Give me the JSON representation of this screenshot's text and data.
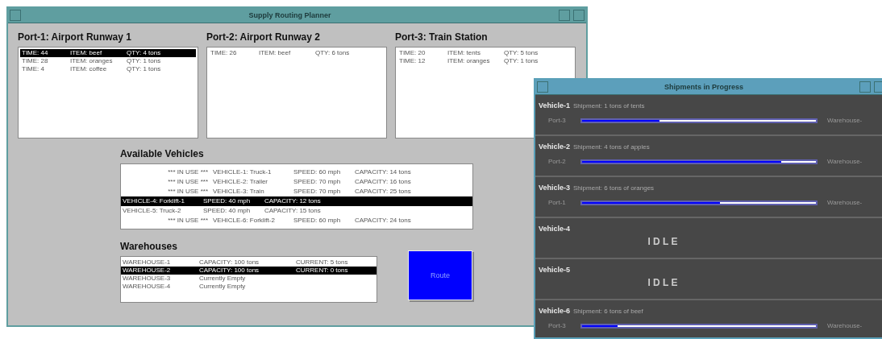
{
  "main_window": {
    "title": "Supply Routing Planner",
    "ports": [
      {
        "title": "Port-1: Airport Runway 1",
        "orders": [
          {
            "time": "TIME: 44",
            "item": "ITEM: beef",
            "qty": "QTY: 4 tons",
            "selected": true
          },
          {
            "time": "TIME: 28",
            "item": "ITEM: oranges",
            "qty": "QTY: 1 tons",
            "selected": false
          },
          {
            "time": "TIME: 4",
            "item": "ITEM: coffee",
            "qty": "QTY: 1 tons",
            "selected": false
          }
        ]
      },
      {
        "title": "Port-2: Airport Runway 2",
        "orders": [
          {
            "time": "TIME: 26",
            "item": "ITEM: beef",
            "qty": "QTY: 6 tons",
            "selected": false
          }
        ]
      },
      {
        "title": "Port-3: Train Station",
        "orders": [
          {
            "time": "TIME: 20",
            "item": "ITEM: tents",
            "qty": "QTY: 5 tons",
            "selected": false
          },
          {
            "time": "TIME: 12",
            "item": "ITEM: oranges",
            "qty": "QTY: 1 tons",
            "selected": false
          }
        ]
      }
    ],
    "vehicles_title": "Available Vehicles",
    "vehicles": [
      {
        "in_use": "*** IN USE ***",
        "vehicle": "VEHICLE-1: Truck-1",
        "speed": "SPEED: 60 mph",
        "capacity": "CAPACITY: 14 tons",
        "selected": false
      },
      {
        "in_use": "*** IN USE ***",
        "vehicle": "VEHICLE-2: Trailer",
        "speed": "SPEED: 70 mph",
        "capacity": "CAPACITY: 16 tons",
        "selected": false
      },
      {
        "in_use": "*** IN USE ***",
        "vehicle": "VEHICLE-3: Train",
        "speed": "SPEED: 70 mph",
        "capacity": "CAPACITY: 25 tons",
        "selected": false
      },
      {
        "vehicle": "VEHICLE-4: Forklift-1",
        "speed": "SPEED: 40 mph",
        "capacity": "CAPACITY: 12 tons",
        "selected": true
      },
      {
        "vehicle": "VEHICLE-5: Truck-2",
        "speed": "SPEED: 40 mph",
        "capacity": "CAPACITY: 15 tons",
        "selected": false
      },
      {
        "in_use": "*** IN USE ***",
        "vehicle": "VEHICLE-6: Forklift-2",
        "speed": "SPEED: 60 mph",
        "capacity": "CAPACITY: 24 tons",
        "selected": false
      }
    ],
    "warehouses_title": "Warehouses",
    "warehouses": [
      {
        "name": "WAREHOUSE-1",
        "capacity": "CAPACITY: 100 tons",
        "current": "CURRENT: 5 tons",
        "selected": false
      },
      {
        "name": "WAREHOUSE-2",
        "capacity": "CAPACITY: 100 tons",
        "current": "CURRENT: 0 tons",
        "selected": true
      },
      {
        "name": "WAREHOUSE-3",
        "capacity": "Currently Empty",
        "selected": false
      },
      {
        "name": "WAREHOUSE-4",
        "capacity": "Currently Empty",
        "selected": false
      }
    ],
    "route_button": "Route"
  },
  "shipments_window": {
    "title": "Shipments in Progress",
    "vehicles": [
      {
        "kind": "moving",
        "name": "Vehicle-1",
        "shipment": "Shipment: 1 tons of tents",
        "from": "Port-3",
        "to": "Warehouse-",
        "level": 0.33
      },
      {
        "kind": "moving",
        "name": "Vehicle-2",
        "shipment": "Shipment: 4 tons of apples",
        "from": "Port-2",
        "to": "Warehouse-",
        "level": 0.85
      },
      {
        "kind": "moving",
        "name": "Vehicle-3",
        "shipment": "Shipment: 6 tons of oranges",
        "from": "Port-1",
        "to": "Warehouse-",
        "level": 0.59
      },
      {
        "kind": "idle",
        "name": "Vehicle-4",
        "status": "I D L E"
      },
      {
        "kind": "idle",
        "name": "Vehicle-5",
        "status": "I D L E"
      },
      {
        "kind": "moving",
        "name": "Vehicle-6",
        "shipment": "Shipment: 6 tons of beef",
        "from": "Port-3",
        "to": "Warehouse-",
        "level": 0.15
      }
    ]
  }
}
